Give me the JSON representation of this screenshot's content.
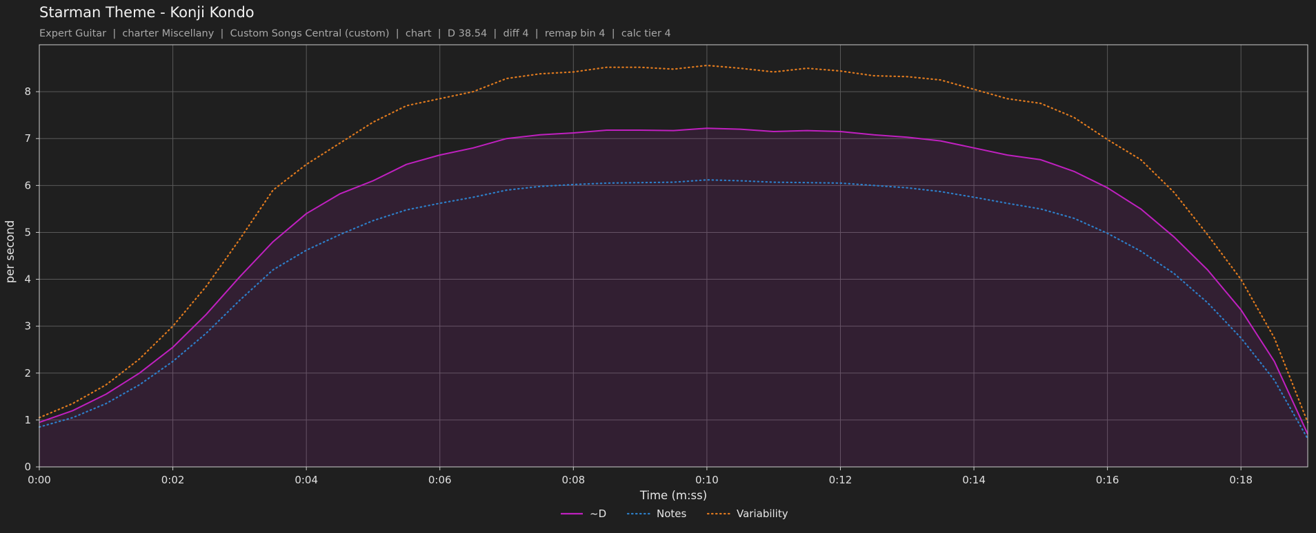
{
  "chart_data": {
    "type": "line",
    "title": "Starman Theme - Konji Kondo",
    "subtitle": "Expert Guitar  |  charter Miscellany  |  Custom Songs Central (custom)  |  chart  |  D 38.54  |  diff 4  |  remap bin 4  |  calc tier 4",
    "xlabel": "Time (m:ss)",
    "ylabel": "per second",
    "xlim": [
      0,
      19
    ],
    "ylim": [
      0,
      9
    ],
    "x_ticks": [
      {
        "value": 0,
        "label": "0:00"
      },
      {
        "value": 2,
        "label": "0:02"
      },
      {
        "value": 4,
        "label": "0:04"
      },
      {
        "value": 6,
        "label": "0:06"
      },
      {
        "value": 8,
        "label": "0:08"
      },
      {
        "value": 10,
        "label": "0:10"
      },
      {
        "value": 12,
        "label": "0:12"
      },
      {
        "value": 14,
        "label": "0:14"
      },
      {
        "value": 16,
        "label": "0:16"
      },
      {
        "value": 18,
        "label": "0:18"
      }
    ],
    "y_ticks": [
      0,
      1,
      2,
      3,
      4,
      5,
      6,
      7,
      8
    ],
    "grid": true,
    "legend": "bottom-center",
    "x": [
      0,
      0.5,
      1.0,
      1.5,
      2.0,
      2.5,
      3.0,
      3.5,
      4.0,
      4.5,
      5.0,
      5.5,
      6.0,
      6.5,
      7.0,
      7.5,
      8.0,
      8.5,
      9.0,
      9.5,
      10.0,
      10.5,
      11.0,
      11.5,
      12.0,
      12.5,
      13.0,
      13.5,
      14.0,
      14.5,
      15.0,
      15.5,
      16.0,
      16.5,
      17.0,
      17.5,
      18.0,
      18.5,
      19.0
    ],
    "series": [
      {
        "name": "~D",
        "color": "#c020c0",
        "style": "solid",
        "fill": true,
        "values": [
          0.95,
          1.2,
          1.55,
          2.0,
          2.55,
          3.25,
          4.05,
          4.8,
          5.4,
          5.82,
          6.1,
          6.45,
          6.65,
          6.8,
          7.0,
          7.08,
          7.12,
          7.18,
          7.18,
          7.17,
          7.22,
          7.2,
          7.15,
          7.17,
          7.15,
          7.08,
          7.03,
          6.95,
          6.8,
          6.65,
          6.55,
          6.3,
          5.95,
          5.5,
          4.9,
          4.2,
          3.35,
          2.25,
          0.7
        ]
      },
      {
        "name": "Notes",
        "color": "#2d7fc9",
        "style": "dotted",
        "fill": false,
        "values": [
          0.85,
          1.05,
          1.35,
          1.75,
          2.25,
          2.85,
          3.55,
          4.2,
          4.62,
          4.95,
          5.25,
          5.48,
          5.62,
          5.75,
          5.9,
          5.98,
          6.02,
          6.05,
          6.06,
          6.07,
          6.12,
          6.1,
          6.07,
          6.06,
          6.05,
          6.0,
          5.95,
          5.87,
          5.75,
          5.62,
          5.5,
          5.3,
          4.98,
          4.6,
          4.12,
          3.5,
          2.75,
          1.85,
          0.6
        ]
      },
      {
        "name": "Variability",
        "color": "#e07a1f",
        "style": "dotted",
        "fill": false,
        "values": [
          1.05,
          1.35,
          1.75,
          2.3,
          3.0,
          3.85,
          4.85,
          5.9,
          6.45,
          6.9,
          7.35,
          7.7,
          7.85,
          8.0,
          8.28,
          8.38,
          8.42,
          8.52,
          8.52,
          8.48,
          8.56,
          8.5,
          8.42,
          8.5,
          8.44,
          8.34,
          8.32,
          8.25,
          8.05,
          7.85,
          7.75,
          7.45,
          6.98,
          6.55,
          5.85,
          4.95,
          4.0,
          2.75,
          0.95
        ]
      }
    ]
  }
}
